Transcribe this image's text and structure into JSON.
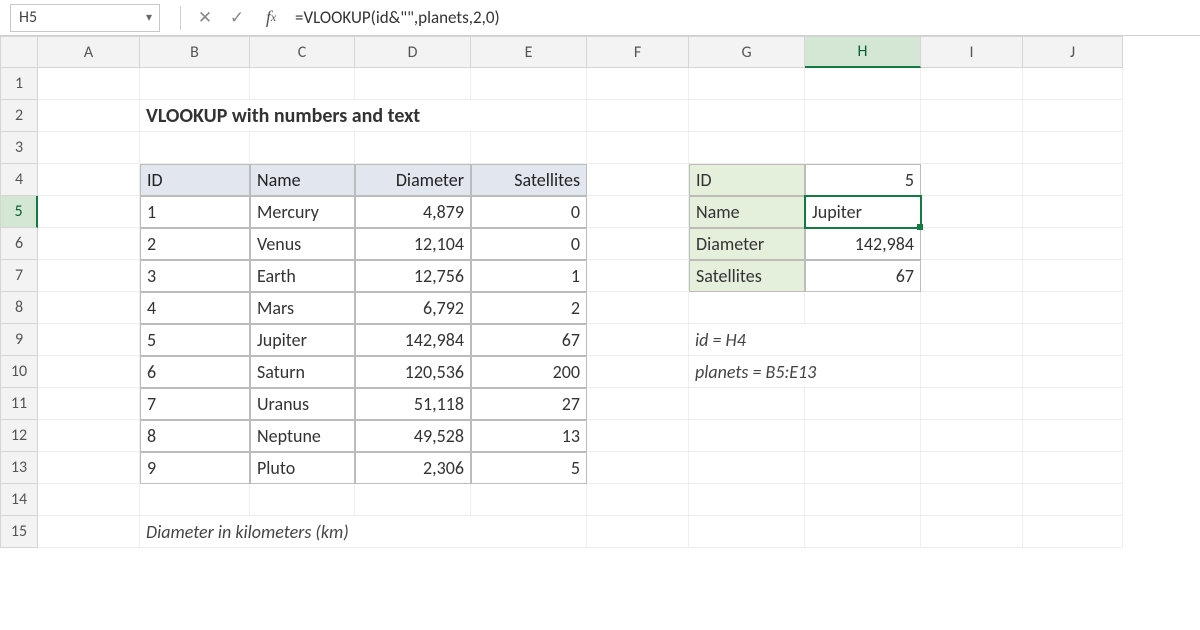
{
  "namebox": {
    "value": "H5"
  },
  "formula_bar": {
    "value": "=VLOOKUP(id&\"\",planets,2,0)"
  },
  "columns": [
    "A",
    "B",
    "C",
    "D",
    "E",
    "F",
    "G",
    "H",
    "I",
    "J"
  ],
  "rows": [
    "1",
    "2",
    "3",
    "4",
    "5",
    "6",
    "7",
    "8",
    "9",
    "10",
    "11",
    "12",
    "13",
    "14",
    "15"
  ],
  "title": "VLOOKUP with numbers and text",
  "table": {
    "headers": [
      "ID",
      "Name",
      "Diameter",
      "Satellites"
    ],
    "rows": [
      {
        "id": "1",
        "name": "Mercury",
        "diameter": "4,879",
        "sat": "0"
      },
      {
        "id": "2",
        "name": "Venus",
        "diameter": "12,104",
        "sat": "0"
      },
      {
        "id": "3",
        "name": "Earth",
        "diameter": "12,756",
        "sat": "1"
      },
      {
        "id": "4",
        "name": "Mars",
        "diameter": "6,792",
        "sat": "2"
      },
      {
        "id": "5",
        "name": "Jupiter",
        "diameter": "142,984",
        "sat": "67"
      },
      {
        "id": "6",
        "name": "Saturn",
        "diameter": "120,536",
        "sat": "200"
      },
      {
        "id": "7",
        "name": "Uranus",
        "diameter": "51,118",
        "sat": "27"
      },
      {
        "id": "8",
        "name": "Neptune",
        "diameter": "49,528",
        "sat": "13"
      },
      {
        "id": "9",
        "name": "Pluto",
        "diameter": "2,306",
        "sat": "5"
      }
    ]
  },
  "lookup": {
    "labels": [
      "ID",
      "Name",
      "Diameter",
      "Satellites"
    ],
    "values": [
      "5",
      "Jupiter",
      "142,984",
      "67"
    ]
  },
  "notes": {
    "id_def": "id = H4",
    "planets_def": "planets = B5:E13",
    "footnote": "Diameter in kilometers (km)"
  },
  "selected_cell": "H5",
  "colors": {
    "header_table": "#e2e6ef",
    "header_lookup": "#e4efdc",
    "excel_green": "#107c41"
  }
}
